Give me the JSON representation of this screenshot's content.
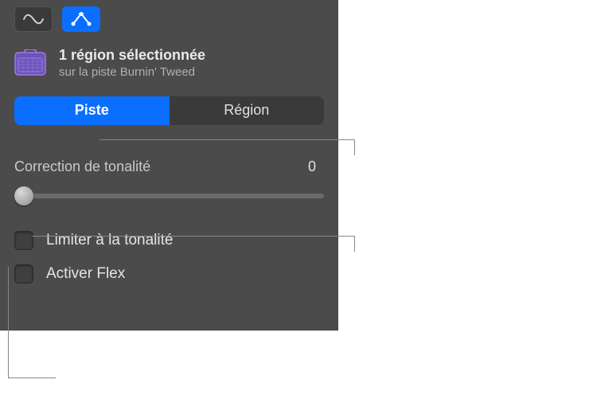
{
  "header": {
    "title": "1 région sélectionnée",
    "subtitle": "sur la piste Burnin' Tweed"
  },
  "tabs": {
    "track": "Piste",
    "region": "Région"
  },
  "toneCorrection": {
    "label": "Correction de tonalité",
    "value": "0"
  },
  "checkboxes": {
    "limitToKey": "Limiter à la tonalité",
    "enableFlex": "Activer Flex"
  },
  "icons": {
    "waveform": "waveform-icon",
    "connectors": "pitch-editor-icon",
    "track": "amp-track-icon"
  },
  "colors": {
    "accent": "#0a6fff",
    "panel": "#4b4b4b",
    "trackIcon": "#9b7be8"
  }
}
